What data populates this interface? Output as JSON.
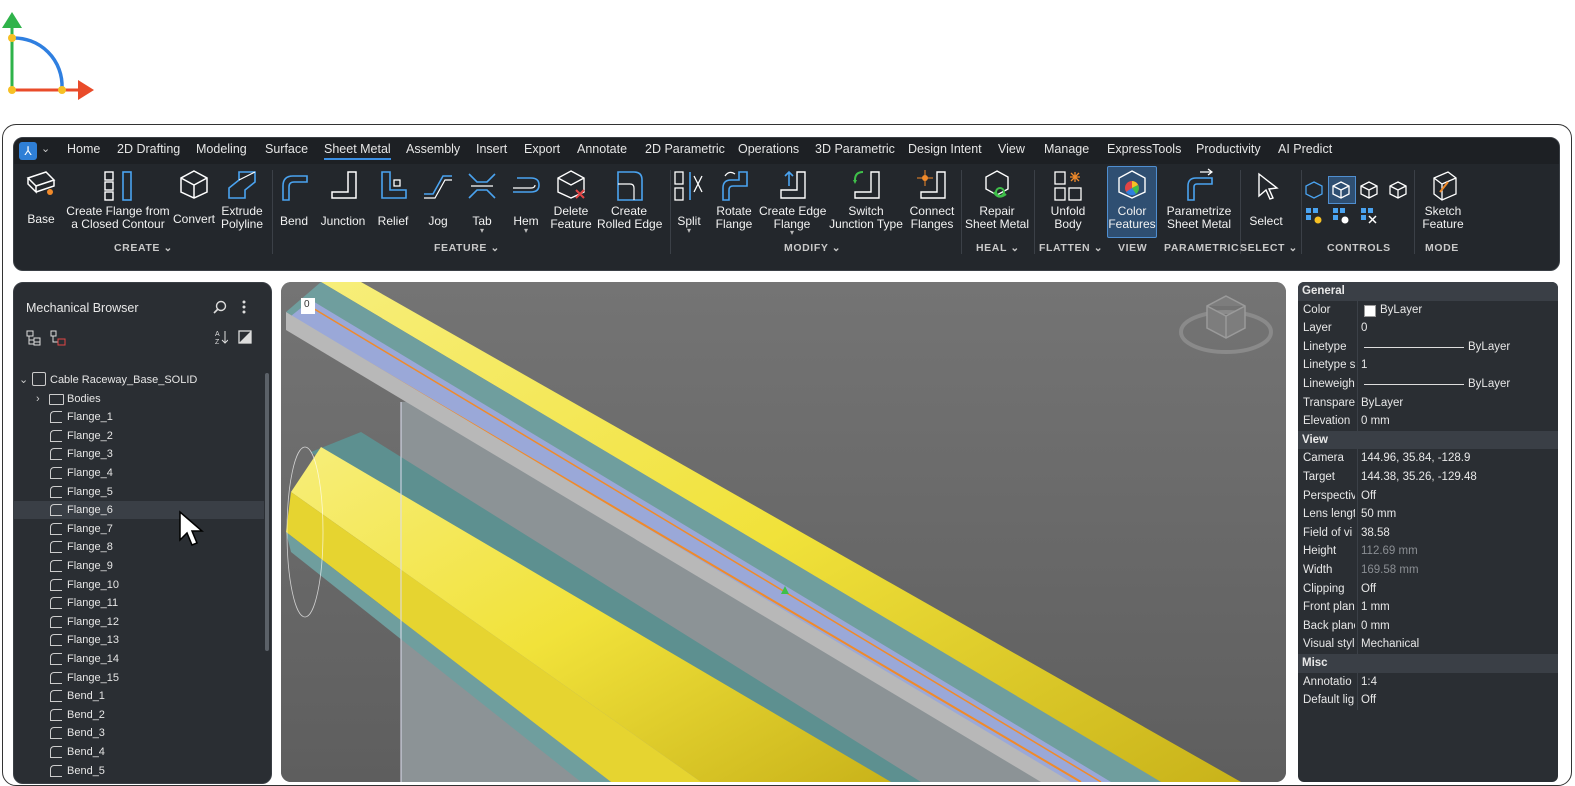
{
  "ribbon": {
    "tabs": [
      "Home",
      "2D Drafting",
      "Modeling",
      "Surface",
      "Sheet Metal",
      "Assembly",
      "Insert",
      "Export",
      "Annotate",
      "2D Parametric",
      "Operations",
      "3D Parametric",
      "Design Intent",
      "View",
      "Manage",
      "ExpressTools",
      "Productivity",
      "AI Predict"
    ],
    "active_tab": "Sheet Metal",
    "tools": [
      {
        "l1": "Base",
        "l2": "",
        "icon": "base-icon"
      },
      {
        "l1": "Create Flange from",
        "l2": "a Closed Contour",
        "icon": "flange-contour-icon"
      },
      {
        "l1": "Convert",
        "l2": "",
        "icon": "convert-icon"
      },
      {
        "l1": "Extrude",
        "l2": "Polyline",
        "icon": "extrude-icon"
      },
      {
        "l1": "Bend",
        "l2": "",
        "icon": "bend-icon"
      },
      {
        "l1": "Junction",
        "l2": "",
        "icon": "junction-icon"
      },
      {
        "l1": "Relief",
        "l2": "",
        "icon": "relief-icon"
      },
      {
        "l1": "Jog",
        "l2": "",
        "icon": "jog-icon"
      },
      {
        "l1": "Tab",
        "l2": "",
        "icon": "tab-icon"
      },
      {
        "l1": "Hem",
        "l2": "",
        "icon": "hem-icon"
      },
      {
        "l1": "Delete",
        "l2": "Feature",
        "icon": "delete-feature-icon"
      },
      {
        "l1": "Create",
        "l2": "Rolled Edge",
        "icon": "rolled-edge-icon"
      },
      {
        "l1": "Split",
        "l2": "",
        "icon": "split-icon"
      },
      {
        "l1": "Rotate",
        "l2": "Flange",
        "icon": "rotate-flange-icon"
      },
      {
        "l1": "Create Edge",
        "l2": "Flange",
        "icon": "edge-flange-icon"
      },
      {
        "l1": "Switch",
        "l2": "Junction Type",
        "icon": "switch-junction-icon"
      },
      {
        "l1": "Connect",
        "l2": "Flanges",
        "icon": "connect-flanges-icon"
      },
      {
        "l1": "Repair",
        "l2": "Sheet Metal",
        "icon": "repair-icon"
      },
      {
        "l1": "Unfold",
        "l2": "Body",
        "icon": "unfold-icon"
      },
      {
        "l1": "Color",
        "l2": "Features",
        "icon": "color-features-icon"
      },
      {
        "l1": "Parametrize",
        "l2": "Sheet Metal",
        "icon": "parametrize-icon"
      },
      {
        "l1": "Select",
        "l2": "",
        "icon": "select-cursor-icon"
      },
      {
        "l1": "Sketch",
        "l2": "Feature",
        "icon": "sketch-feature-icon"
      }
    ],
    "groups": [
      "CREATE",
      "FEATURE",
      "MODIFY",
      "HEAL",
      "FLATTEN",
      "VIEW",
      "PARAMETRIC",
      "SELECT",
      "CONTROLS",
      "MODE"
    ]
  },
  "browser": {
    "title": "Mechanical Browser",
    "root": "Cable Raceway_Base_SOLID",
    "items": [
      "Bodies",
      "Flange_1",
      "Flange_2",
      "Flange_3",
      "Flange_4",
      "Flange_5",
      "Flange_6",
      "Flange_7",
      "Flange_8",
      "Flange_9",
      "Flange_10",
      "Flange_11",
      "Flange_12",
      "Flange_13",
      "Flange_14",
      "Flange_15",
      "Bend_1",
      "Bend_2",
      "Bend_3",
      "Bend_4",
      "Bend_5"
    ],
    "highlighted": "Flange_6"
  },
  "viewport": {
    "corner_label": "0"
  },
  "properties": {
    "sections": [
      {
        "title": "General",
        "rows": [
          {
            "k": "Color",
            "v": "ByLayer"
          },
          {
            "k": "Layer",
            "v": "0"
          },
          {
            "k": "Linetype",
            "v": "ByLayer"
          },
          {
            "k": "Linetype s",
            "v": "1"
          },
          {
            "k": "Lineweigh",
            "v": "ByLayer"
          },
          {
            "k": "Transpare",
            "v": "ByLayer"
          },
          {
            "k": "Elevation",
            "v": "0 mm"
          }
        ]
      },
      {
        "title": "View",
        "rows": [
          {
            "k": "Camera",
            "v": "144.96, 35.84, -128.9"
          },
          {
            "k": "Target",
            "v": "144.38, 35.26, -129.48"
          },
          {
            "k": "Perspectiv",
            "v": "Off"
          },
          {
            "k": "Lens lengt",
            "v": "50 mm"
          },
          {
            "k": "Field of vi",
            "v": "38.58"
          },
          {
            "k": "Height",
            "v": "112.69 mm"
          },
          {
            "k": "Width",
            "v": "169.58 mm"
          },
          {
            "k": "Clipping",
            "v": "Off"
          },
          {
            "k": "Front plan",
            "v": "1 mm"
          },
          {
            "k": "Back plane",
            "v": "0 mm"
          },
          {
            "k": "Visual styl",
            "v": "Mechanical"
          }
        ]
      },
      {
        "title": "Misc",
        "rows": [
          {
            "k": "Annotatio",
            "v": "1:4"
          },
          {
            "k": "Default lig",
            "v": "Off"
          }
        ]
      }
    ]
  }
}
